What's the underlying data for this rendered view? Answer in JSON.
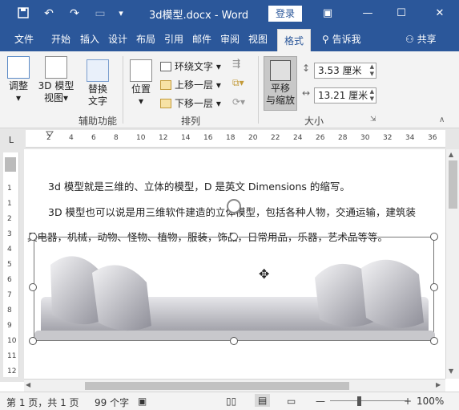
{
  "titlebar": {
    "doc_title": "3d模型.docx  -  Word",
    "login_label": "登录"
  },
  "tabs": [
    "文件",
    "开始",
    "插入",
    "设计",
    "布局",
    "引用",
    "邮件",
    "审阅",
    "视图",
    "格式"
  ],
  "tell_me": "告诉我",
  "share": "共享",
  "ribbon": {
    "adjust_label": "调整",
    "model3d_label_1": "3D 模型",
    "model3d_label_2": "视图",
    "replace_label_1": "替换",
    "replace_label_2": "文字",
    "aux_group": "辅助功能",
    "position_label": "位置",
    "wrap_text": "环绕文字",
    "bring_forward": "上移一层",
    "send_backward": "下移一层",
    "arrange_group": "排列",
    "pan_zoom_1": "平移",
    "pan_zoom_2": "与缩放",
    "height_value": "3.53 厘米",
    "width_value": "13.21 厘米",
    "size_group": "大小"
  },
  "ruler": {
    "corner": "L",
    "ticks": [
      "2",
      "4",
      "6",
      "8",
      "10",
      "12",
      "14",
      "16",
      "18",
      "20",
      "22",
      "24",
      "26",
      "28",
      "30",
      "32",
      "34",
      "36"
    ]
  },
  "vruler_ticks": [
    "1",
    "1",
    "2",
    "3",
    "4",
    "5",
    "6",
    "7",
    "8",
    "9",
    "10",
    "11",
    "12"
  ],
  "document": {
    "para1": "3d 模型就是三维的、立体的模型，D 是英文 Dimensions 的缩写。",
    "para2": "3D 模型也可以说是用三维软件建造的立体模型，包括各种人物，交通运输，建筑装",
    "para3": "具电器，机械，动物、怪物、植物，服装，饰品，日常用品，乐器，艺术品等等。"
  },
  "status": {
    "pages": "第 1 页，共 1 页",
    "words": "99 个字",
    "zoom": "100%"
  },
  "colors": {
    "title_bar": "#2b579a",
    "ribbon_bg": "#f3f3f3"
  }
}
